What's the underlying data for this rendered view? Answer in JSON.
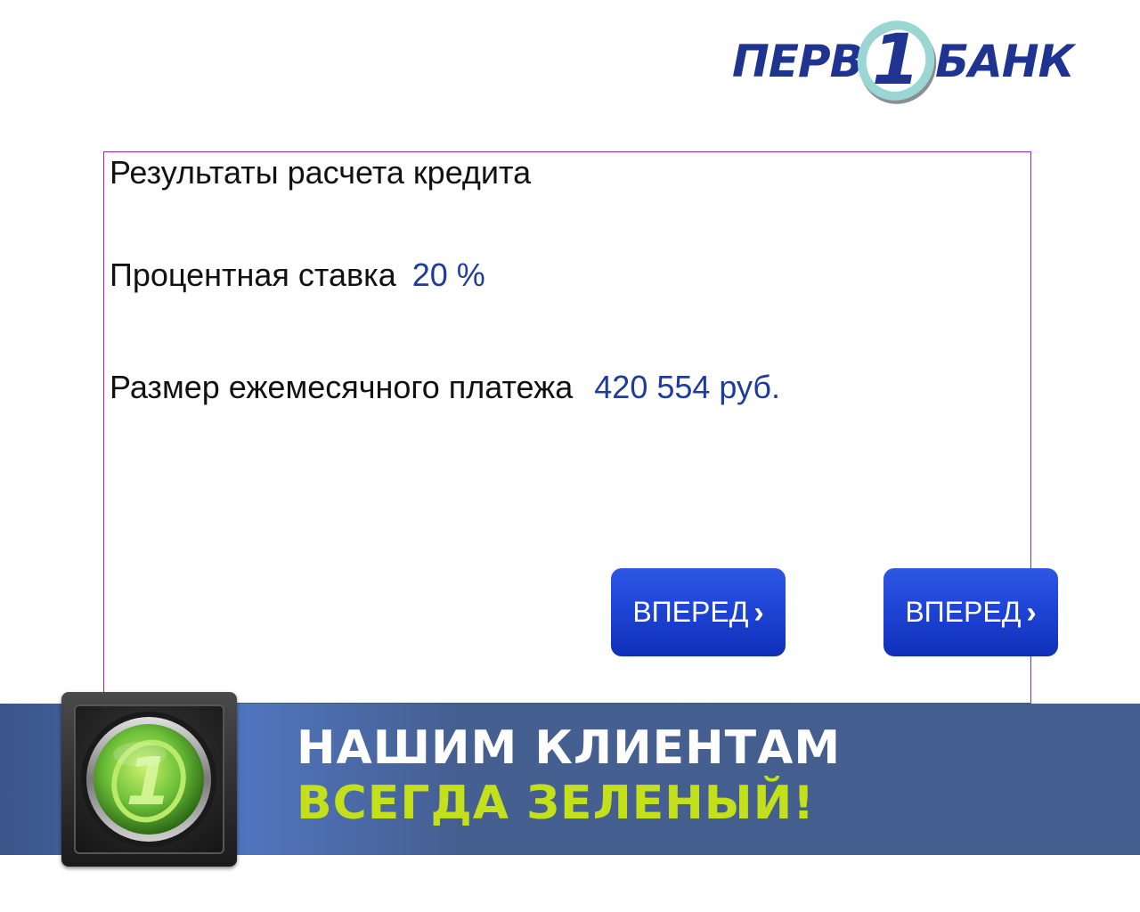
{
  "logo": {
    "text_left": "ПЕРВ",
    "mark_digit": "1",
    "text_right": "БАНК",
    "colors": {
      "text": "#1f3391",
      "mark_ring": "#9ad6d4",
      "mark_swoosh": "#8a8f96"
    }
  },
  "results": {
    "title": "Результаты расчета кредита",
    "rate_label": "Процентная ставка",
    "rate_value": "20 %",
    "payment_label": "Размер ежемесячного платежа",
    "payment_value": "420 554 руб."
  },
  "buttons": [
    {
      "label": "ВПЕРЕД",
      "chevron": "›"
    },
    {
      "label": "ВПЕРЕД",
      "chevron": "›"
    }
  ],
  "banner": {
    "line1": "НАШИМ КЛИЕНТАМ",
    "line2": "ВСЕГДА ЗЕЛЕНЫЙ!",
    "light_digit": "1",
    "colors": {
      "line1": "#ffffff",
      "line2": "#c4e01a",
      "background": "#435e8f",
      "light": "#6fc23a"
    }
  },
  "colors": {
    "accent": "#1e3b9e",
    "button": "#1f45d6",
    "panel_border": "#a028a8"
  }
}
